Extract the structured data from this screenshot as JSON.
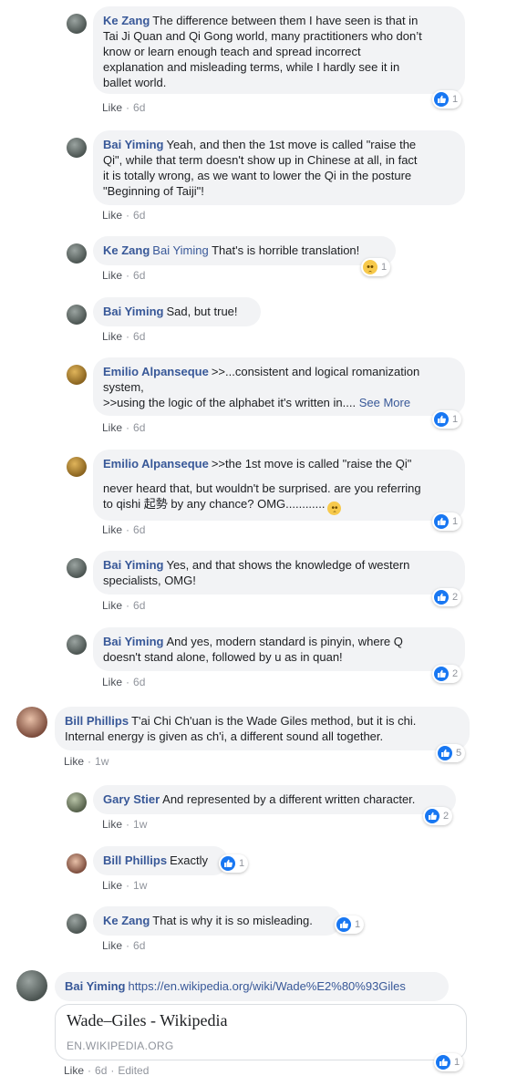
{
  "comments": [
    {
      "author": "Ke Zang",
      "text_lines": [
        "The difference between them I have seen is that in",
        "Tai Ji Quan and Qi Gong world, many practitioners who don’t",
        "know or learn enough teach and spread incorrect",
        "explanation and misleading terms, while I hardly see it in",
        "ballet world."
      ],
      "action": "Like",
      "time": "6d",
      "reaction_count": "1"
    },
    {
      "author": "Bai Yiming",
      "text_lines": [
        "Yeah, and then the 1st move is called \"raise the",
        "Qi\", while that term doesn't show up in Chinese at all, in fact",
        "it is totally wrong, as we want to lower the Qi in the posture",
        "\"Beginning of Taiji\"!"
      ],
      "action": "Like",
      "time": "6d"
    },
    {
      "author": "Ke Zang",
      "mention": "Bai Yiming",
      "text": "That's is horrible translation!",
      "action": "Like",
      "time": "6d",
      "reaction_count": "1"
    },
    {
      "author": "Bai Yiming",
      "text": "Sad, but true!",
      "action": "Like",
      "time": "6d"
    },
    {
      "author": "Emilio Alpanseque",
      "text_lines": [
        ">>...consistent and logical romanization",
        "system,",
        ">>using the logic of the alphabet it's written in...."
      ],
      "see_more": "See More",
      "action": "Like",
      "time": "6d",
      "reaction_count": "1"
    },
    {
      "author": "Emilio Alpanseque",
      "text_lines": [
        ">>the 1st move is called \"raise the Qi\"",
        "never heard that, but wouldn't be surprised. are you referring",
        "to qishi 起勢 by any chance? OMG............"
      ],
      "action": "Like",
      "time": "6d",
      "reaction_count": "1"
    },
    {
      "author": "Bai Yiming",
      "text_lines": [
        "Yes, and that shows the knowledge of western",
        "specialists, OMG!"
      ],
      "action": "Like",
      "time": "6d",
      "reaction_count": "2"
    },
    {
      "author": "Bai Yiming",
      "text_lines": [
        "And yes, modern standard is pinyin, where Q",
        "doesn't stand alone, followed by u as in quan!"
      ],
      "action": "Like",
      "time": "6d",
      "reaction_count": "2"
    },
    {
      "author": "Bill Phillips",
      "text_lines": [
        "T'ai Chi Ch'uan is the Wade Giles method, but it is chi.",
        "Internal energy is given as ch'i, a different sound all together."
      ],
      "action": "Like",
      "time": "1w",
      "reaction_count": "5"
    },
    {
      "author": "Gary Stier",
      "text": "And represented by a different written character.",
      "action": "Like",
      "time": "1w",
      "reaction_count": "2"
    },
    {
      "author": "Bill Phillips",
      "text": "Exactly",
      "action": "Like",
      "time": "1w",
      "reaction_count": "1"
    },
    {
      "author": "Ke Zang",
      "text": "That is why it is so misleading.",
      "action": "Like",
      "time": "6d",
      "reaction_count": "1"
    },
    {
      "author": "Bai Yiming",
      "link": "https://en.wikipedia.org/wiki/Wade%E2%80%93Giles",
      "preview_title": "Wade–Giles - Wikipedia",
      "preview_domain": "EN.WIKIPEDIA.ORG",
      "action": "Like",
      "time": "6d",
      "edited": "Edited",
      "reaction_count": "1"
    }
  ]
}
